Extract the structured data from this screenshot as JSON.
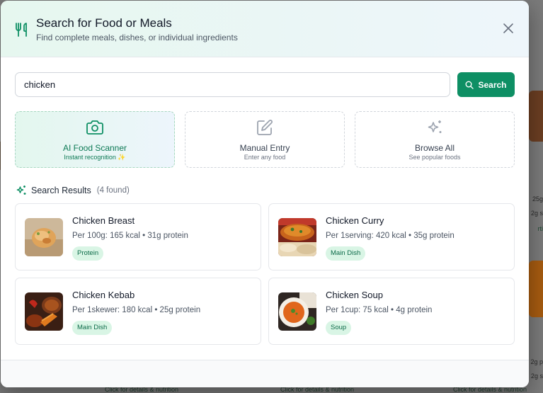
{
  "background": {
    "right_snippets": [
      "25g",
      "2g s",
      "rti",
      "2g p",
      "2g s"
    ],
    "bottom_links": [
      "Click for details & nutrition",
      "Click for details & nutrition",
      "Click for details & nutrition"
    ]
  },
  "modal": {
    "title": "Search for Food or Meals",
    "subtitle": "Find complete meals, dishes, or individual ingredients",
    "header_icon": "utensils-icon",
    "close_icon": "close-icon"
  },
  "search": {
    "value": "chicken",
    "placeholder": "",
    "button_label": "Search",
    "button_icon": "search-icon"
  },
  "options": [
    {
      "title": "AI Food Scanner",
      "subtitle": "Instant recognition ✨",
      "icon": "camera-icon"
    },
    {
      "title": "Manual Entry",
      "subtitle": "Enter any food",
      "icon": "edit-icon"
    },
    {
      "title": "Browse All",
      "subtitle": "See popular foods",
      "icon": "sparkles-icon"
    }
  ],
  "results": {
    "title": "Search Results",
    "count": "(4 found)",
    "icon": "sparkles-icon",
    "items": [
      {
        "name": "Chicken Breast",
        "info": "Per 100g: 165 kcal • 31g protein",
        "tag": "Protein"
      },
      {
        "name": "Chicken Curry",
        "info": "Per 1serving: 420 kcal • 35g protein",
        "tag": "Main Dish"
      },
      {
        "name": "Chicken Kebab",
        "info": "Per 1skewer: 180 kcal • 25g protein",
        "tag": "Main Dish"
      },
      {
        "name": "Chicken Soup",
        "info": "Per 1cup: 75 kcal • 4g protein",
        "tag": "Soup"
      }
    ]
  },
  "colors": {
    "primary": "#0e8f64",
    "tag_bg": "#d9f5e5",
    "tag_text": "#0d6b49"
  }
}
